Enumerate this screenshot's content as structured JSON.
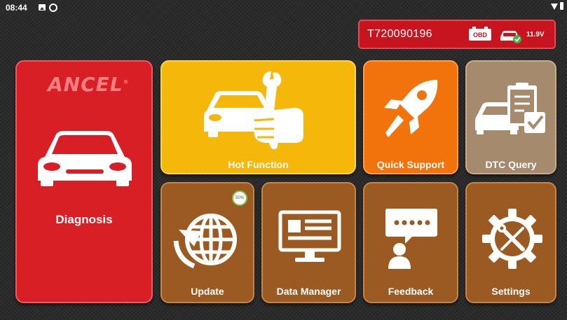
{
  "statusbar": {
    "time": "08:44",
    "icons": [
      "image-icon",
      "at-icon",
      "wifi-icon",
      "battery-icon"
    ]
  },
  "vci": {
    "serial": "T720090196",
    "obd_label": "OBD",
    "voltage": "11.9V",
    "connected": true
  },
  "tiles": {
    "diagnosis": {
      "label": "Diagnosis",
      "brand": "ANCEL",
      "icon": "car-icon",
      "color": "#d91f26"
    },
    "hot_function": {
      "label": "Hot Function",
      "icon": "car-wrench-icon",
      "color": "#f5b70a"
    },
    "quick_support": {
      "label": "Quick Support",
      "icon": "rocket-icon",
      "color": "#f2730b"
    },
    "dtc_query": {
      "label": "DTC Query",
      "icon": "car-clipboard-icon",
      "color": "#a68a6d"
    },
    "update": {
      "label": "Update",
      "icon": "globe-refresh-icon",
      "progress_text": "50%",
      "progress": 0.5,
      "color": "#9b5a22"
    },
    "data_manager": {
      "label": "Data Manager",
      "icon": "monitor-icon",
      "color": "#9b5a22"
    },
    "feedback": {
      "label": "Feedback",
      "icon": "chat-person-icon",
      "color": "#9b5a22"
    },
    "settings": {
      "label": "Settings",
      "icon": "gear-tools-icon",
      "color": "#9b5a22"
    }
  }
}
